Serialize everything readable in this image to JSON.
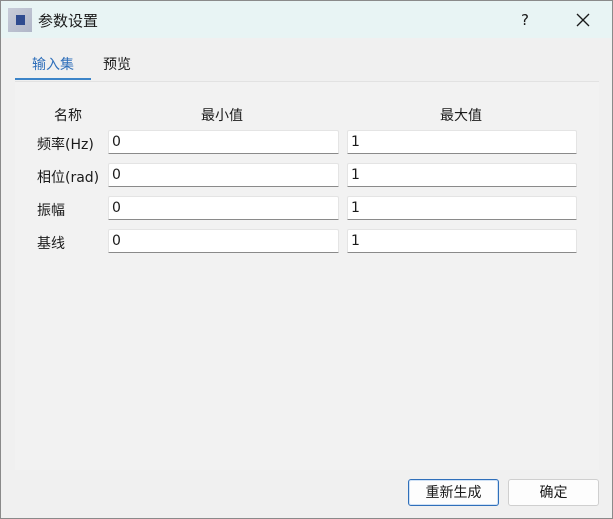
{
  "window": {
    "title": "参数设置",
    "help_label": "?"
  },
  "tabs": [
    {
      "label": "输入集",
      "active": true
    },
    {
      "label": "预览",
      "active": false
    }
  ],
  "table": {
    "headers": {
      "name": "名称",
      "min": "最小值",
      "max": "最大值"
    },
    "rows": [
      {
        "name": "频率(Hz)",
        "min": "0",
        "max": "1"
      },
      {
        "name": "相位(rad)",
        "min": "0",
        "max": "1"
      },
      {
        "name": "振幅",
        "min": "0",
        "max": "1"
      },
      {
        "name": "基线",
        "min": "0",
        "max": "1"
      }
    ]
  },
  "buttons": {
    "regenerate": "重新生成",
    "ok": "确定"
  },
  "colors": {
    "titlebar_bg": "#e8f4f4",
    "accent": "#2f6fba",
    "window_bg": "#f0f0f0"
  },
  "icons": {
    "app": "app-icon",
    "close": "close-icon"
  }
}
